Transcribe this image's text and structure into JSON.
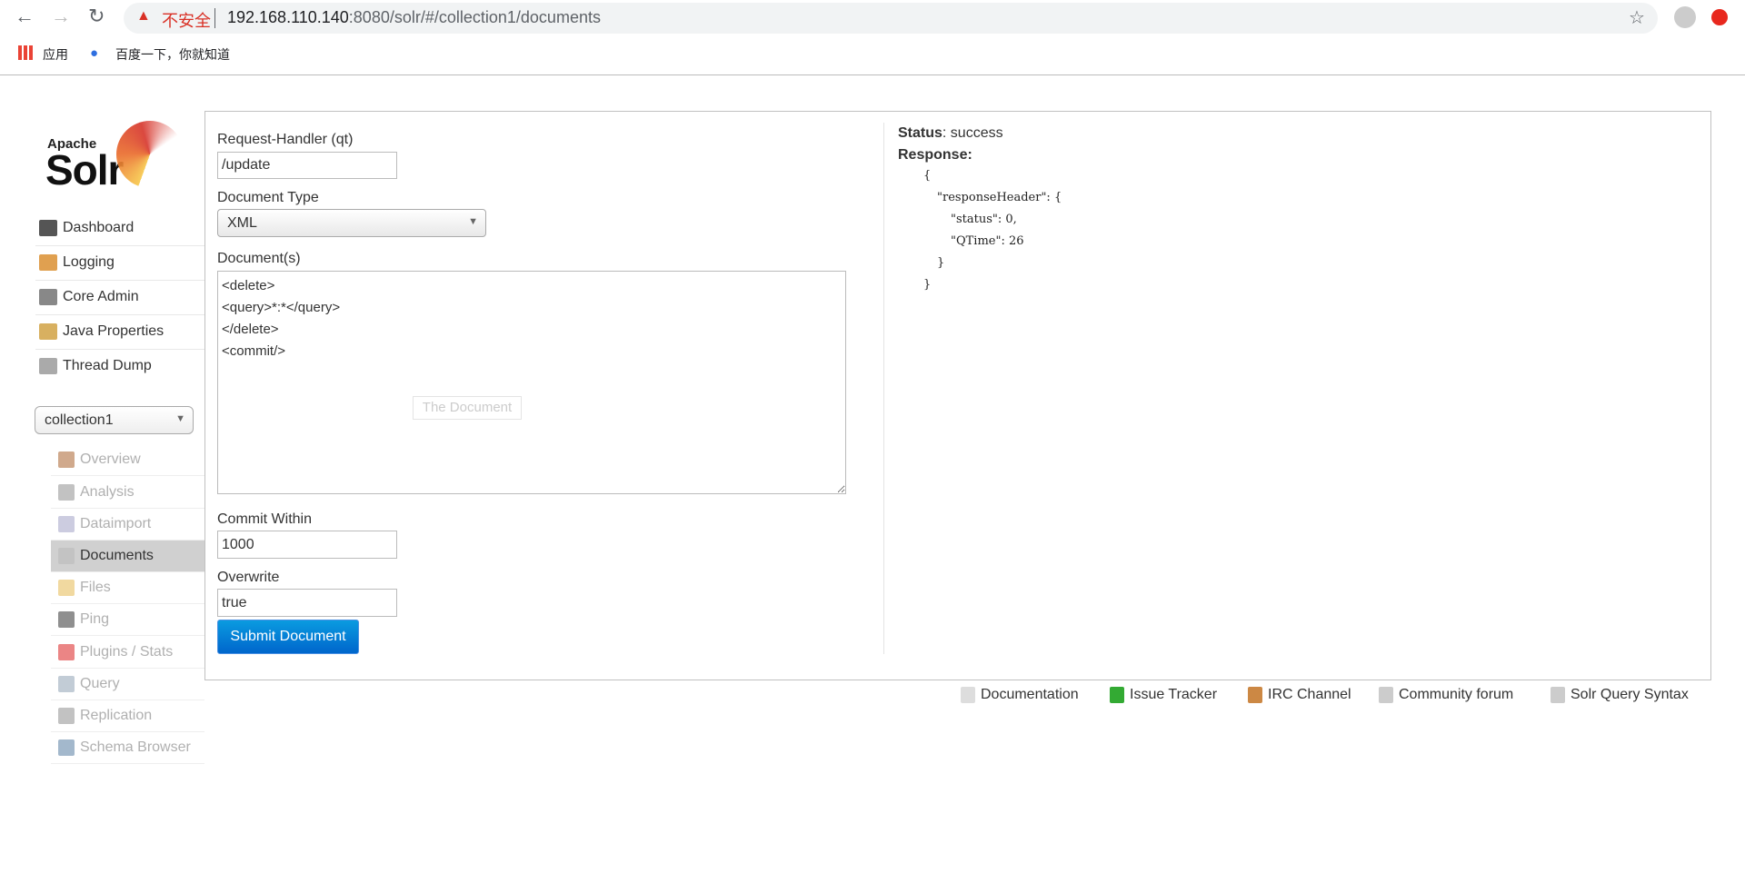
{
  "browser": {
    "url_host": "192.168.110.140",
    "url_rest": ":8080/solr/#/collection1/documents",
    "security_label": "不安全",
    "bookmarks": [
      "应用",
      "百度一下，你就知道"
    ]
  },
  "logo": {
    "text_small": "Apache",
    "text_big": "Solr"
  },
  "sidebar": {
    "items": [
      {
        "label": "Dashboard",
        "icon": "dashboard-icon"
      },
      {
        "label": "Logging",
        "icon": "logging-icon"
      },
      {
        "label": "Core Admin",
        "icon": "core-admin-icon"
      },
      {
        "label": "Java Properties",
        "icon": "java-icon"
      },
      {
        "label": "Thread Dump",
        "icon": "thread-icon"
      }
    ],
    "core_selector": "collection1",
    "core_items": [
      {
        "label": "Overview"
      },
      {
        "label": "Analysis"
      },
      {
        "label": "Dataimport"
      },
      {
        "label": "Documents",
        "active": true
      },
      {
        "label": "Files"
      },
      {
        "label": "Ping"
      },
      {
        "label": "Plugins / Stats"
      },
      {
        "label": "Query"
      },
      {
        "label": "Replication"
      },
      {
        "label": "Schema Browser"
      }
    ]
  },
  "form": {
    "handler_label": "Request-Handler (qt)",
    "handler_value": "/update",
    "doctype_label": "Document Type",
    "doctype_value": "XML",
    "docs_label": "Document(s)",
    "docs_value": "<delete>\n<query>*:*</query>\n</delete>\n<commit/>",
    "docs_placeholder": "The Document",
    "commit_label": "Commit Within",
    "commit_value": "1000",
    "overwrite_label": "Overwrite",
    "overwrite_value": "true",
    "submit_label": "Submit Document"
  },
  "result": {
    "status_label": "Status",
    "status_value": "success",
    "response_label": "Response:",
    "json_lines": [
      "{",
      "\"responseHeader\": {",
      "\"status\": 0,",
      "\"QTime\": 26",
      "}",
      "}"
    ]
  },
  "footer": [
    "Documentation",
    "Issue Tracker",
    "IRC Channel",
    "Community forum",
    "Solr Query Syntax"
  ],
  "colors": {
    "accent": "#0a7dd8",
    "active_bg": "#d0d0d0"
  }
}
